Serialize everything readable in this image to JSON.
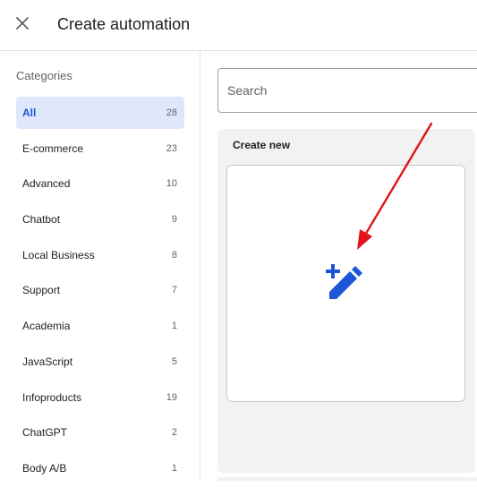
{
  "header": {
    "title": "Create automation"
  },
  "sidebar": {
    "heading": "Categories",
    "items": [
      {
        "label": "All",
        "count": "28"
      },
      {
        "label": "E-commerce",
        "count": "23"
      },
      {
        "label": "Advanced",
        "count": "10"
      },
      {
        "label": "Chatbot",
        "count": "9"
      },
      {
        "label": "Local Business",
        "count": "8"
      },
      {
        "label": "Support",
        "count": "7"
      },
      {
        "label": "Academia",
        "count": "1"
      },
      {
        "label": "JavaScript",
        "count": "5"
      },
      {
        "label": "Infoproducts",
        "count": "19"
      },
      {
        "label": "ChatGPT",
        "count": "2"
      },
      {
        "label": "Body A/B",
        "count": "1"
      }
    ]
  },
  "search": {
    "placeholder": "Search",
    "value": ""
  },
  "main": {
    "section_title": "Create new",
    "create_card_icon": "edit-add-icon"
  },
  "colors": {
    "accent": "#1a56d6",
    "active_bg": "#dfe8fb",
    "annotation_arrow": "#e0141b",
    "panel_bg": "#f2f2f2"
  }
}
